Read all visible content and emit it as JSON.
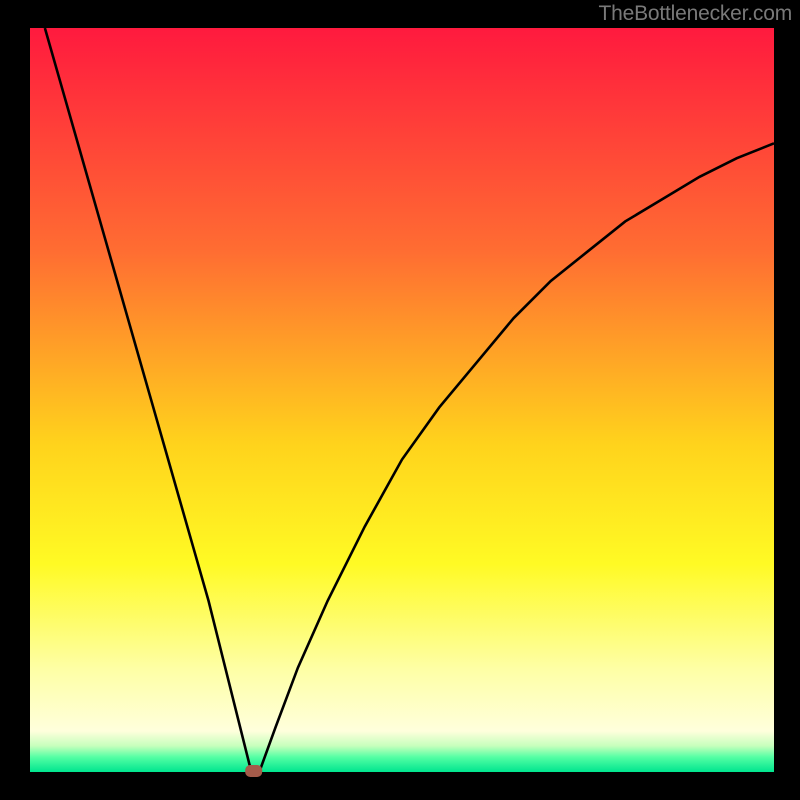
{
  "attribution": "TheBottlenecker.com",
  "colors": {
    "black": "#000000",
    "marker": "#a45b4a"
  },
  "chart_data": {
    "type": "line",
    "title": "",
    "xlabel": "",
    "ylabel": "",
    "xlim": [
      0,
      100
    ],
    "ylim": [
      0,
      100
    ],
    "gradient_stops": [
      {
        "pos": 0.0,
        "color": "#ff1a3e"
      },
      {
        "pos": 0.3,
        "color": "#ff6d32"
      },
      {
        "pos": 0.56,
        "color": "#ffd31c"
      },
      {
        "pos": 0.72,
        "color": "#fffa24"
      },
      {
        "pos": 0.86,
        "color": "#feffa4"
      },
      {
        "pos": 0.945,
        "color": "#ffffdc"
      },
      {
        "pos": 0.965,
        "color": "#c6ffbc"
      },
      {
        "pos": 0.98,
        "color": "#54ffa4"
      },
      {
        "pos": 1.0,
        "color": "#00e58f"
      }
    ],
    "series": [
      {
        "name": "bottleneck-curve",
        "x": [
          2,
          4,
          6,
          8,
          10,
          12,
          14,
          16,
          18,
          20,
          22,
          24,
          26,
          28,
          29.5,
          30,
          31,
          33,
          36,
          40,
          45,
          50,
          55,
          60,
          65,
          70,
          75,
          80,
          85,
          90,
          95,
          100
        ],
        "y": [
          100,
          93,
          86,
          79,
          72,
          65,
          58,
          51,
          44,
          37,
          30,
          23,
          15,
          7,
          1,
          0,
          0.5,
          6,
          14,
          23,
          33,
          42,
          49,
          55,
          61,
          66,
          70,
          74,
          77,
          80,
          82.5,
          84.5
        ]
      }
    ],
    "marker": {
      "x": 30,
      "y": 0,
      "shape": "rounded-rect"
    }
  }
}
